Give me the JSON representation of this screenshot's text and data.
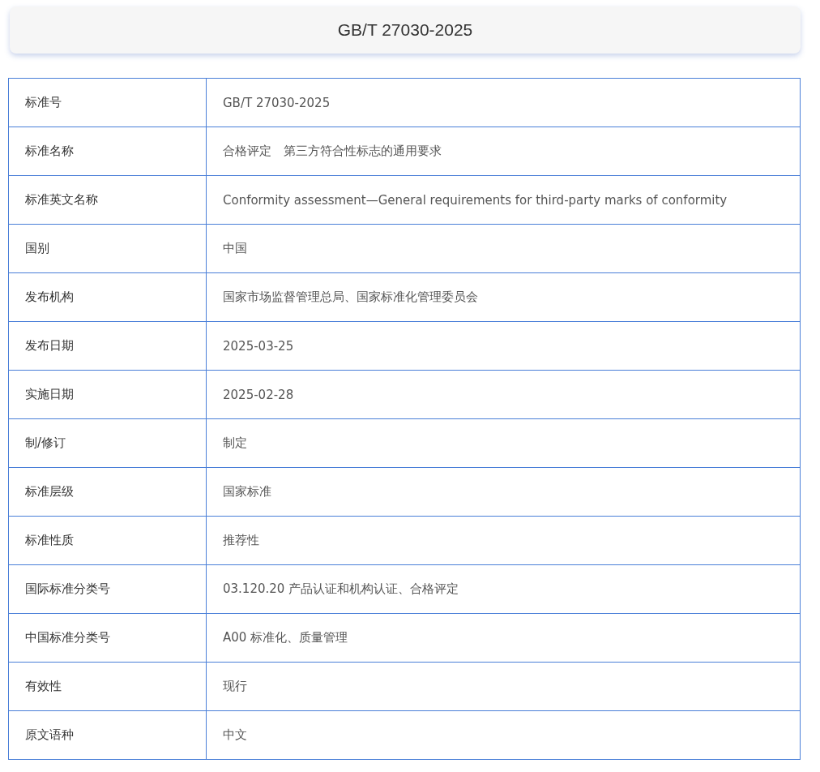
{
  "title": "GB/T 27030-2025",
  "rows": [
    {
      "label": "标准号",
      "value": "GB/T 27030-2025"
    },
    {
      "label": "标准名称",
      "value": "合格评定　第三方符合性标志的通用要求"
    },
    {
      "label": "标准英文名称",
      "value": "Conformity assessment—General requirements for third-party marks of conformity"
    },
    {
      "label": "国别",
      "value": "中国"
    },
    {
      "label": "发布机构",
      "value": "国家市场监督管理总局、国家标准化管理委员会"
    },
    {
      "label": "发布日期",
      "value": "2025-03-25"
    },
    {
      "label": "实施日期",
      "value": "2025-02-28"
    },
    {
      "label": "制/修订",
      "value": "制定"
    },
    {
      "label": "标准层级",
      "value": "国家标准"
    },
    {
      "label": "标准性质",
      "value": "推荐性"
    },
    {
      "label": "国际标准分类号",
      "value": "03.120.20 产品认证和机构认证、合格评定"
    },
    {
      "label": "中国标准分类号",
      "value": "A00 标准化、质量管理"
    },
    {
      "label": "有效性",
      "value": "现行"
    },
    {
      "label": "原文语种",
      "value": "中文"
    }
  ]
}
